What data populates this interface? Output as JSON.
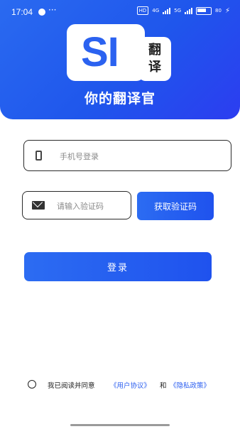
{
  "status_bar": {
    "time": "17:04",
    "more": "···",
    "hd_label": "HD",
    "net1": "4G",
    "net2": "5G",
    "battery_label": "80"
  },
  "header": {
    "logo_text": "SI",
    "logo_tag_line1": "翻",
    "logo_tag_line2": "译",
    "slogan": "你的翻译官",
    "accent_color": "#1f56ec"
  },
  "form": {
    "phone": {
      "placeholder": "手机号登录",
      "value": ""
    },
    "code": {
      "placeholder": "请输入验证码",
      "value": ""
    },
    "get_code_label": "获取验证码",
    "login_label": "登录"
  },
  "agreement": {
    "checked": false,
    "text": "我已阅读并同意",
    "user_link": "《用户协议》",
    "and": "和",
    "privacy_link": "《隐私政策》"
  },
  "icons": {
    "phone": "phone-icon",
    "mail": "mail-icon"
  }
}
